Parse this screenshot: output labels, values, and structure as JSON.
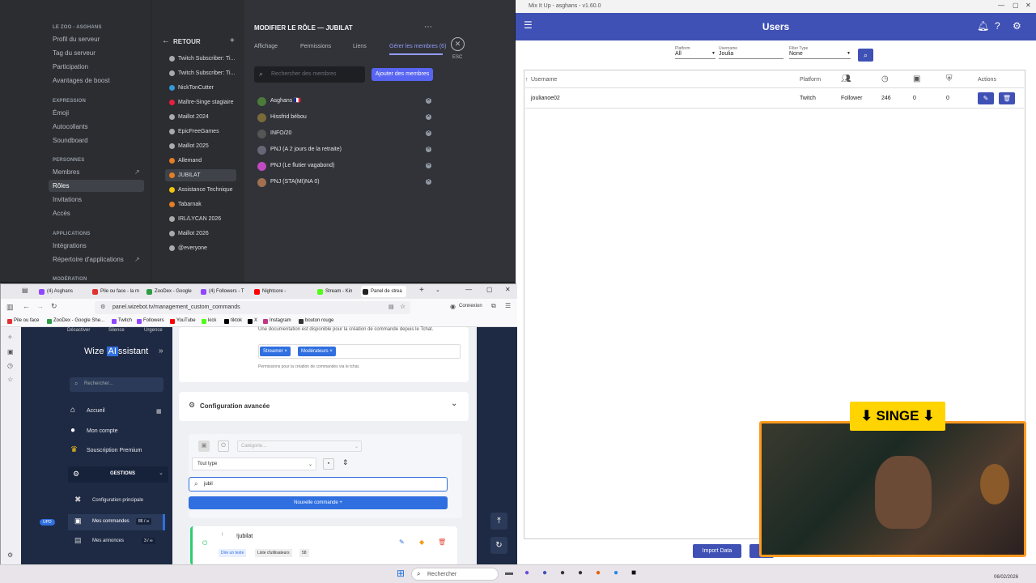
{
  "discord": {
    "server": "LE ZOO - ASGHANS",
    "server_items": [
      "Profil du serveur",
      "Tag du serveur",
      "Participation",
      "Avantages de boost"
    ],
    "expression_head": "EXPRESSION",
    "expression_items": [
      "Émoji",
      "Autocollants",
      "Soundboard"
    ],
    "people_head": "PERSONNES",
    "people_items": [
      "Membres",
      "Rôles",
      "Invitations",
      "Accès"
    ],
    "apps_head": "APPLICATIONS",
    "apps_items": [
      "Intégrations",
      "Répertoire d'applications"
    ],
    "moderation_head": "MODÉRATION",
    "back": "RETOUR",
    "roles": [
      {
        "name": "Twitch Subscriber: Ti...",
        "color": "#aaaaaa"
      },
      {
        "name": "Twitch Subscriber: Ti...",
        "color": "#aaaaaa"
      },
      {
        "name": "NickTonCutter",
        "color": "#3498db"
      },
      {
        "name": "Maître-Singe stagiaire",
        "color": "#e91e3c"
      },
      {
        "name": "Maillot 2024",
        "color": "#aaaaaa"
      },
      {
        "name": "EpicFreeGames",
        "color": "#aaaaaa"
      },
      {
        "name": "Maillot 2025",
        "color": "#aaaaaa"
      },
      {
        "name": "Allemand",
        "color": "#e67e22"
      },
      {
        "name": "JUBILAT",
        "color": "#e67e22"
      },
      {
        "name": "Assistance Technique",
        "color": "#f1c40f"
      },
      {
        "name": "Tabarnak",
        "color": "#e67e22"
      },
      {
        "name": "IRL/LYCAN 2026",
        "color": "#aaaaaa"
      },
      {
        "name": "Maillot 2026",
        "color": "#aaaaaa"
      },
      {
        "name": "@everyone",
        "color": "#aaaaaa"
      }
    ],
    "edit_title": "MODIFIER LE RÔLE — JUBILAT",
    "tabs": [
      "Affichage",
      "Permissions",
      "Liens",
      "Gérer les membres (6)"
    ],
    "esc": "ESC",
    "search_placeholder": "Rechercher des membres",
    "add_members": "Ajouter des membres",
    "members": [
      "Asghans 🇫🇷",
      "Hissfrid bébou",
      "INFO/20",
      "PNJ (A 2 jours de la retraite)",
      "PNJ (Le flutier vagabond)",
      "PNJ (STA(MI)NA 0)"
    ]
  },
  "mix": {
    "window_title": "Mix It Up - asghans - v1.60.0",
    "title": "Users",
    "platform_label": "Platform",
    "platform_value": "All",
    "username_label": "Username",
    "username_value": "Joulia",
    "filter_label": "Filter Type",
    "filter_value": "None",
    "col_username": "Username",
    "col_platform": "Platform",
    "col_actions": "Actions",
    "row": {
      "username": "joulianoe02",
      "platform": "Twitch",
      "role": "Follower",
      "v1": "246",
      "v2": "0",
      "v3": "0"
    },
    "import": "Import Data"
  },
  "browser": {
    "tabs": [
      "(4) Asghans",
      "Pile ou face - la m",
      "ZooDex - Google",
      "(4) Followers - T",
      "Nightcore -",
      "Stream - Kin",
      "Panel de strea"
    ],
    "url": "panel.wizebot.tv/management_custom_commands",
    "connexion": "Connexion",
    "bookmarks": [
      "Pile ou face",
      "ZooDex - Google She...",
      "Twitch",
      "Followers",
      "YouTube",
      "kick",
      "tiktok",
      "X",
      "Instagram",
      "bouton rouge"
    ]
  },
  "wize": {
    "top": [
      "Désactiver",
      "Silence",
      "Urgence"
    ],
    "logo": "WizeAIssistant",
    "search": "Rechercher...",
    "nav": [
      "Accueil",
      "Mon compte",
      "Souscription Premium"
    ],
    "gestions": "GESTIONS",
    "sub": [
      "Configuration principale",
      "Mes commandes",
      "Mes annonces"
    ],
    "cmd_count": "86 / ∞",
    "ann_count": "3 / ∞",
    "upd": "UPD",
    "doc_note": "Une documentation est disponible pour la création de commande depuis le Tchat.",
    "chips": [
      "Streamer",
      "Modérateurs"
    ],
    "perm_note": "Permissions pour la création de commandes via le tchat.",
    "advanced": "Configuration avancée",
    "category": "Catégorie...",
    "type": "Tout type",
    "search_value": "jubil",
    "new_cmd": "Nouvelle commande",
    "cmd_name": "!jubilat",
    "cmd_tags": [
      "Dire un texte",
      "Liste d'utilisateurs"
    ],
    "cmd_stat": "58"
  },
  "overlay": {
    "singe": "SINGE"
  },
  "taskbar": {
    "search": "Rechercher",
    "date": "06/02/2026"
  }
}
